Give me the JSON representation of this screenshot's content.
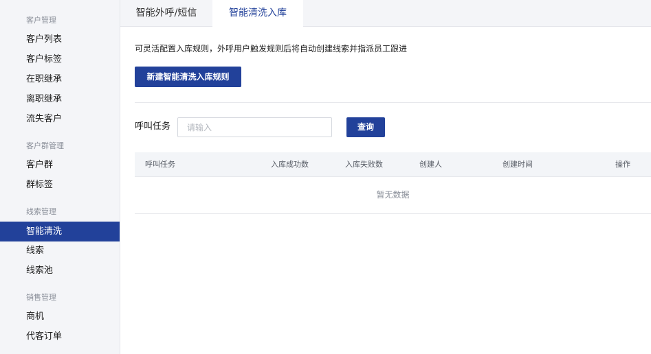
{
  "sidebar": {
    "groups": [
      {
        "title": "客户管理",
        "items": [
          "客户列表",
          "客户标签",
          "在职继承",
          "离职继承",
          "流失客户"
        ]
      },
      {
        "title": "客户群管理",
        "items": [
          "客户群",
          "群标签"
        ]
      },
      {
        "title": "线索管理",
        "items": [
          "智能清洗",
          "线索",
          "线索池"
        ]
      },
      {
        "title": "销售管理",
        "items": [
          "商机",
          "代客订单"
        ]
      }
    ],
    "active_item": "智能清洗"
  },
  "tabs": [
    {
      "label": "智能外呼/短信",
      "active": false
    },
    {
      "label": "智能清洗入库",
      "active": true
    }
  ],
  "main": {
    "description": "可灵活配置入库规则，外呼用户触发规则后将自动创建线索并指派员工跟进",
    "new_rule_button": "新建智能清洗入库规则",
    "filter": {
      "label": "呼叫任务",
      "placeholder": "请输入",
      "value": ""
    },
    "query_button": "查询",
    "table": {
      "columns": [
        "呼叫任务",
        "入库成功数",
        "入库失败数",
        "创建人",
        "创建时间",
        "操作"
      ],
      "rows": [],
      "empty_text": "暂无数据"
    }
  },
  "colors": {
    "primary": "#22419a",
    "sidebar_bg": "#f4f5f8"
  }
}
